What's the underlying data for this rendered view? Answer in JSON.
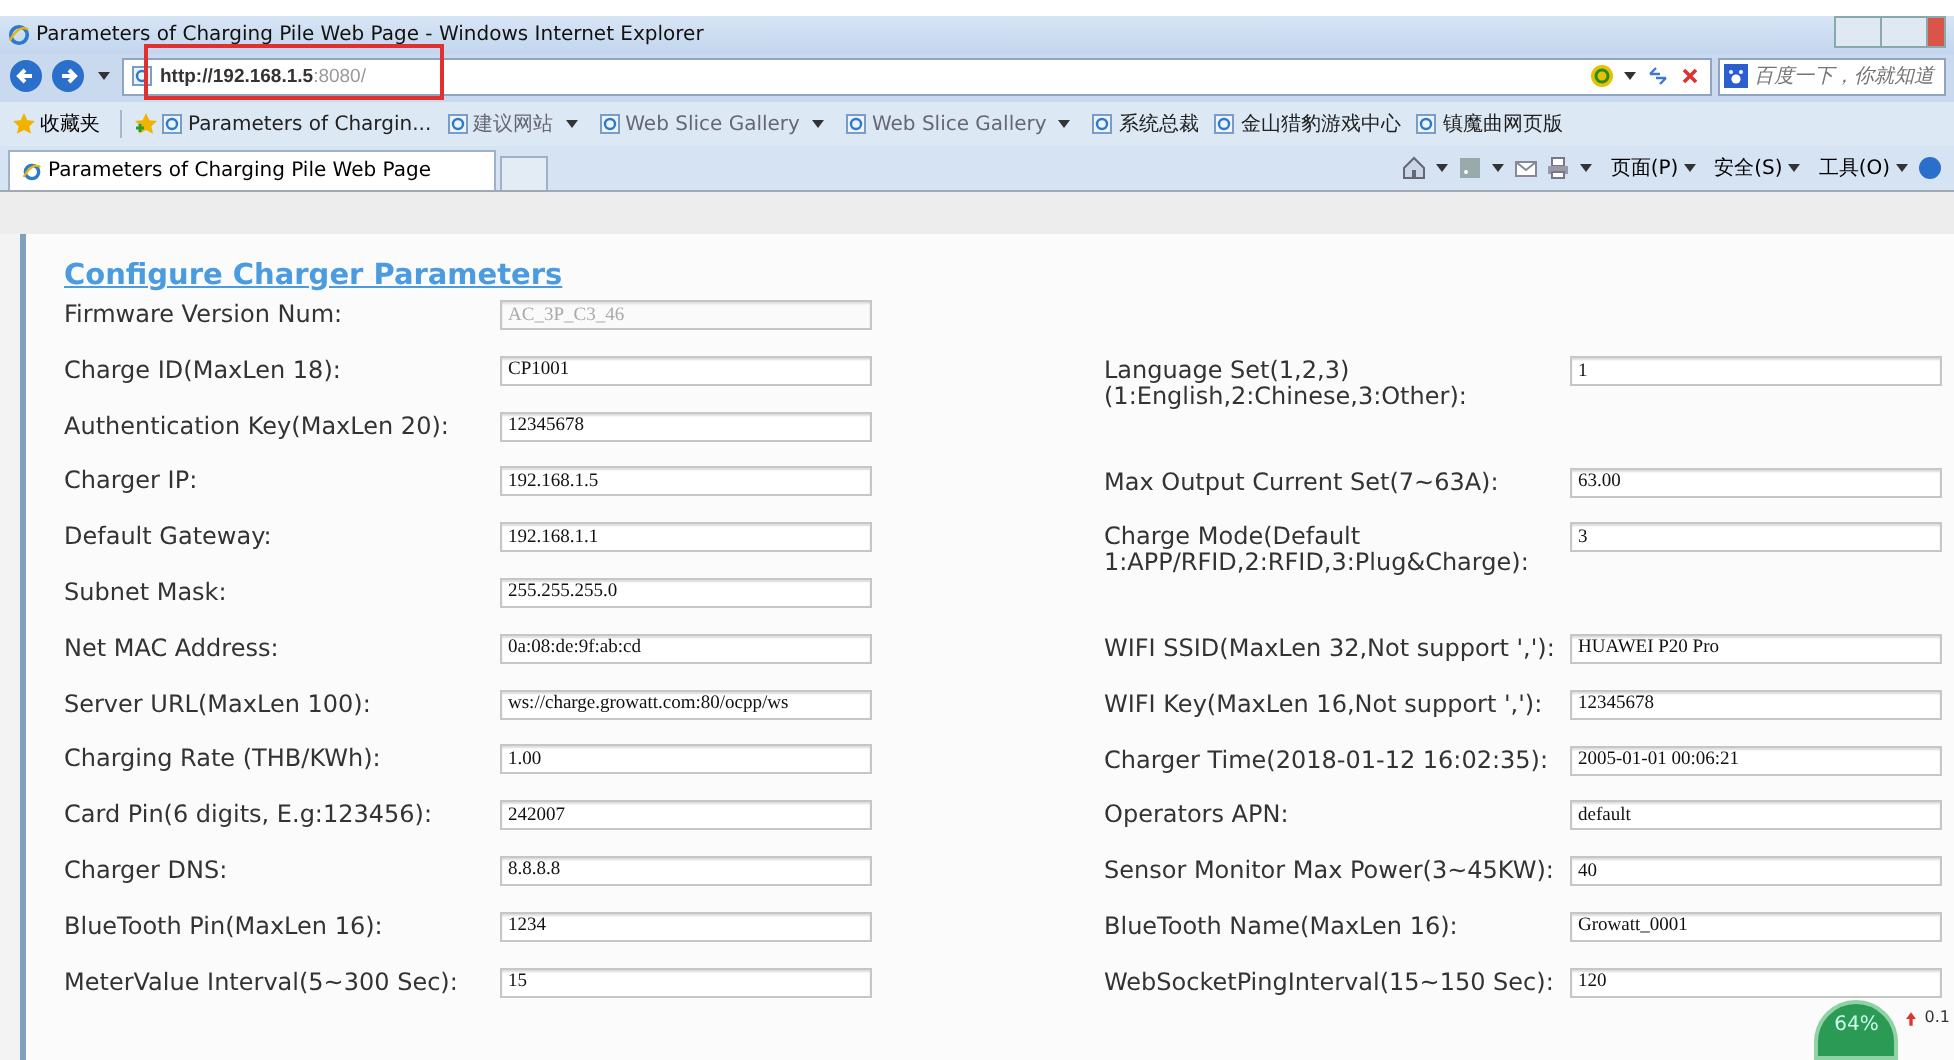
{
  "window": {
    "title": "Parameters of Charging Pile Web Page - Windows Internet Explorer"
  },
  "address_bar": {
    "url_host": "http://192.168.1.5",
    "url_port": ":8080/",
    "search_placeholder": "百度一下，你就知道"
  },
  "favorites_bar": {
    "label": "收藏夹",
    "items": [
      {
        "label": "Parameters of Chargin...",
        "dropdown": false,
        "dim": false
      },
      {
        "label": "建议网站",
        "dropdown": true,
        "dim": true
      },
      {
        "label": "Web Slice Gallery",
        "dropdown": true,
        "dim": true
      },
      {
        "label": "Web Slice Gallery",
        "dropdown": true,
        "dim": true
      },
      {
        "label": "系统总裁",
        "dropdown": false,
        "dim": false
      },
      {
        "label": "金山猎豹游戏中心",
        "dropdown": false,
        "dim": false
      },
      {
        "label": "镇魔曲网页版",
        "dropdown": false,
        "dim": false
      }
    ]
  },
  "tabs": [
    {
      "label": "Parameters of Charging Pile Web Page",
      "selected": true
    }
  ],
  "command_bar": [
    "页面(P)",
    "安全(S)",
    "工具(O)"
  ],
  "form": {
    "title": "Configure Charger Parameters",
    "left": [
      {
        "label": "Firmware Version Num:",
        "value": "AC_3P_C3_46",
        "disabled": true,
        "kind": "single"
      },
      {
        "label": "Charge ID(MaxLen 18):",
        "value": "CP1001",
        "disabled": false,
        "kind": "single"
      },
      {
        "label": "Authentication Key(MaxLen 20):",
        "value": "12345678",
        "disabled": false,
        "kind": "single"
      },
      {
        "label": "Charger IP:",
        "value": "192.168.1.5",
        "disabled": false,
        "kind": "single"
      },
      {
        "label": "Default Gateway:",
        "value": "192.168.1.1",
        "disabled": false,
        "kind": "single"
      },
      {
        "label": "Subnet Mask:",
        "value": "255.255.255.0",
        "disabled": false,
        "kind": "single"
      },
      {
        "label": "Net MAC Address:",
        "value": "0a:08:de:9f:ab:cd",
        "disabled": false,
        "kind": "single"
      },
      {
        "label": "Server URL(MaxLen 100):",
        "value": "ws://charge.growatt.com:80/ocpp/ws",
        "disabled": false,
        "kind": "single"
      },
      {
        "label": "Charging Rate (THB/KWh):",
        "value": "1.00",
        "disabled": false,
        "kind": "single"
      },
      {
        "label": "Card Pin(6 digits, E.g:123456):",
        "value": "242007",
        "disabled": false,
        "kind": "single"
      },
      {
        "label": "Charger DNS:",
        "value": "8.8.8.8",
        "disabled": false,
        "kind": "single"
      },
      {
        "label": "BlueTooth Pin(MaxLen 16):",
        "value": "1234",
        "disabled": false,
        "kind": "single"
      },
      {
        "label": "MeterValue Interval(5~300 Sec):",
        "value": "15",
        "disabled": false,
        "kind": "single"
      }
    ],
    "right": [
      {
        "label": "Language Set(1,2,3) (1:English,2:Chinese,3:Other):",
        "value": "1",
        "disabled": false,
        "kind": "double"
      },
      {
        "label": "Max Output Current Set(7~63A):",
        "value": "63.00",
        "disabled": false,
        "kind": "single"
      },
      {
        "label": "Charge Mode(Default 1:APP/RFID,2:RFID,3:Plug&Charge):",
        "value": "3",
        "disabled": false,
        "kind": "double"
      },
      {
        "label": "WIFI SSID(MaxLen 32,Not support ','):",
        "value": "HUAWEI P20 Pro",
        "disabled": false,
        "kind": "single"
      },
      {
        "label": "WIFI Key(MaxLen 16,Not support ','):",
        "value": "12345678",
        "disabled": false,
        "kind": "single"
      },
      {
        "label": "Charger Time(2018-01-12 16:02:35):",
        "value": "2005-01-01 00:06:21",
        "disabled": false,
        "kind": "single"
      },
      {
        "label": "Operators APN:",
        "value": "default",
        "disabled": false,
        "kind": "single"
      },
      {
        "label": "Sensor Monitor Max Power(3~45KW):",
        "value": "40",
        "disabled": false,
        "kind": "single"
      },
      {
        "label": "BlueTooth Name(MaxLen 16):",
        "value": "Growatt_0001",
        "disabled": false,
        "kind": "single"
      },
      {
        "label": "WebSocketPingInterval(15~150 Sec):",
        "value": "120",
        "disabled": false,
        "kind": "single"
      }
    ]
  },
  "speed_widget": {
    "percent": "64%",
    "speed": "0.1"
  }
}
